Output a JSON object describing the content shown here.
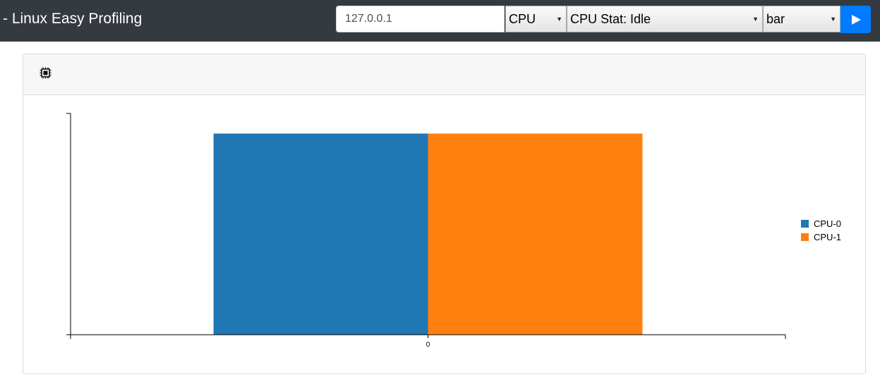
{
  "header": {
    "brand": "- Linux Easy Profiling",
    "host_value": "127.0.0.1",
    "category_select": "CPU",
    "stat_select": "CPU Stat: Idle",
    "chart_type_select": "bar",
    "run_icon": "play-icon"
  },
  "card": {
    "header_icon": "chip-icon"
  },
  "colors": {
    "topbar": "#343a40",
    "run_button": "#007bff",
    "series_0": "#1f77b4",
    "series_1": "#ff7f0e"
  },
  "chart_data": {
    "type": "bar",
    "categories": [
      "0"
    ],
    "series": [
      {
        "name": "CPU-0",
        "values": [
          1
        ]
      },
      {
        "name": "CPU-1",
        "values": [
          1
        ]
      }
    ],
    "title": "",
    "xlabel": "",
    "ylabel": "",
    "grid": false,
    "legend": "right"
  }
}
